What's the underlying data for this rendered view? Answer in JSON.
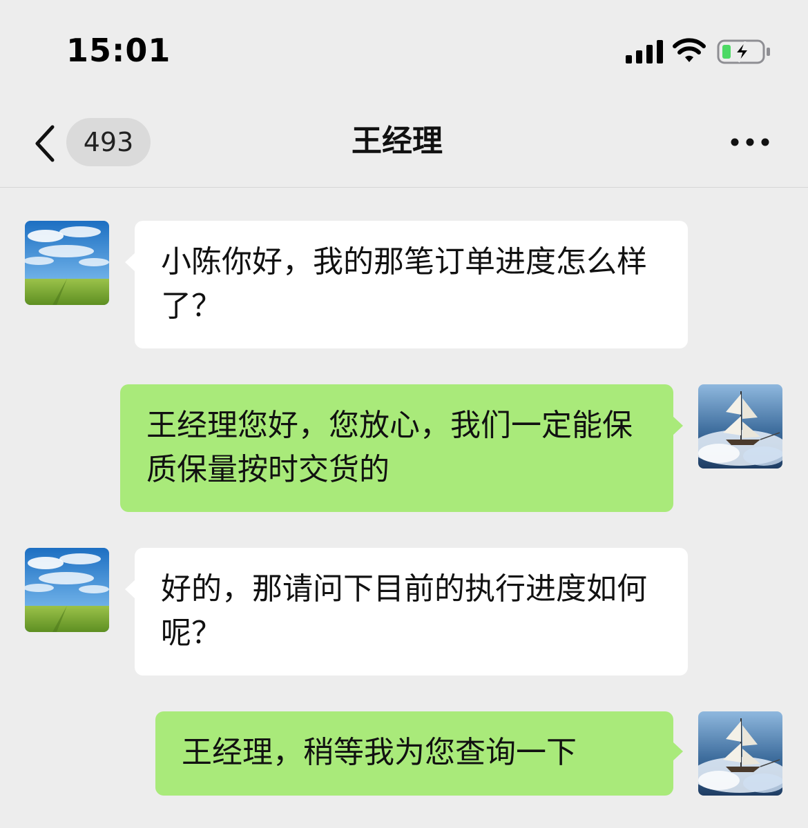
{
  "status_bar": {
    "time": "15:01",
    "icons": [
      "signal-icon",
      "wifi-icon",
      "battery-charging-icon"
    ]
  },
  "nav": {
    "back_icon": "chevron-left-icon",
    "unread_count": "493",
    "title": "王经理",
    "more_icon": "more-dots-icon"
  },
  "messages": [
    {
      "side": "incoming",
      "avatar": "landscape-avatar",
      "text": "小陈你好，我的那笔订单进度怎么样了？"
    },
    {
      "side": "outgoing",
      "avatar": "sailboat-avatar",
      "text": "王经理您好，您放心，我们一定能保质保量按时交货的"
    },
    {
      "side": "incoming",
      "avatar": "landscape-avatar",
      "text": "好的，那请问下目前的执行进度如何呢？"
    },
    {
      "side": "outgoing",
      "avatar": "sailboat-avatar",
      "text": "王经理，稍等我为您查询一下"
    }
  ],
  "colors": {
    "background": "#ededed",
    "incoming_bubble": "#ffffff",
    "outgoing_bubble": "#a9ea7a",
    "badge": "#dadada",
    "battery_level": "#4cd964"
  }
}
